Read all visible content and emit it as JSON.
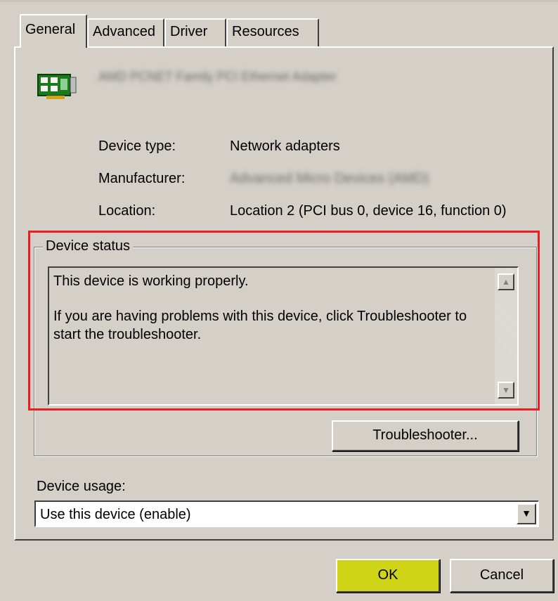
{
  "tabs": [
    "General",
    "Advanced",
    "Driver",
    "Resources"
  ],
  "device": {
    "name": "AMD PCNET Family PCI Ethernet Adapter",
    "properties": [
      {
        "label": "Device type:",
        "value": "Network adapters"
      },
      {
        "label": "Manufacturer:",
        "value": "Advanced Micro Devices (AMD)"
      },
      {
        "label": "Location:",
        "value": "Location 2 (PCI bus 0, device 16, function 0)"
      }
    ]
  },
  "status": {
    "group_title": "Device status",
    "line1": "This device is working properly.",
    "line2": "If you are having problems with this device, click Troubleshooter to start the troubleshooter."
  },
  "troubleshooter_label": "Troubleshooter...",
  "usage": {
    "label": "Device usage:",
    "selected": "Use this device (enable)"
  },
  "buttons": {
    "ok": "OK",
    "cancel": "Cancel"
  },
  "colors": {
    "window": "#d4d0c8",
    "highlight_border": "#ec1c24",
    "ok_button": "#d0d416"
  },
  "icons": [
    "network-adapter-icon",
    "scroll-up-icon",
    "scroll-down-icon",
    "dropdown-arrow-icon"
  ]
}
